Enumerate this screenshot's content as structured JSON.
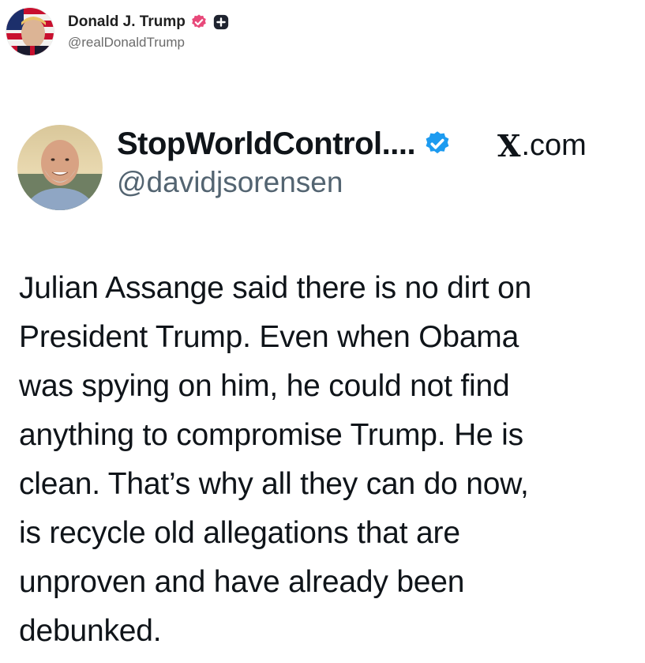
{
  "post": {
    "author_name": "Donald J. Trump",
    "author_handle": "@realDonaldTrump"
  },
  "embed": {
    "name": "StopWorldControl....",
    "handle": "@davidjsorensen",
    "source_name": "X",
    "source_suffix": ".com",
    "text": "Julian Assange said there is no dirt on\nPresident Trump. Even when Obama\nwas spying on him, he could not find\nanything to compromise Trump. He is\nclean. That’s why all they can do now,\nis recycle old allegations that are\nunproven and have already been\ndebunked."
  },
  "colors": {
    "verified_pink": "#e8497a",
    "verified_blue": "#1d9bf0",
    "text_primary": "#0f1419",
    "text_secondary": "#536471"
  },
  "icons": {
    "author_badge": "verified-badge-icon",
    "author_plus": "plus-badge-icon",
    "embed_badge": "verified-check-icon"
  }
}
